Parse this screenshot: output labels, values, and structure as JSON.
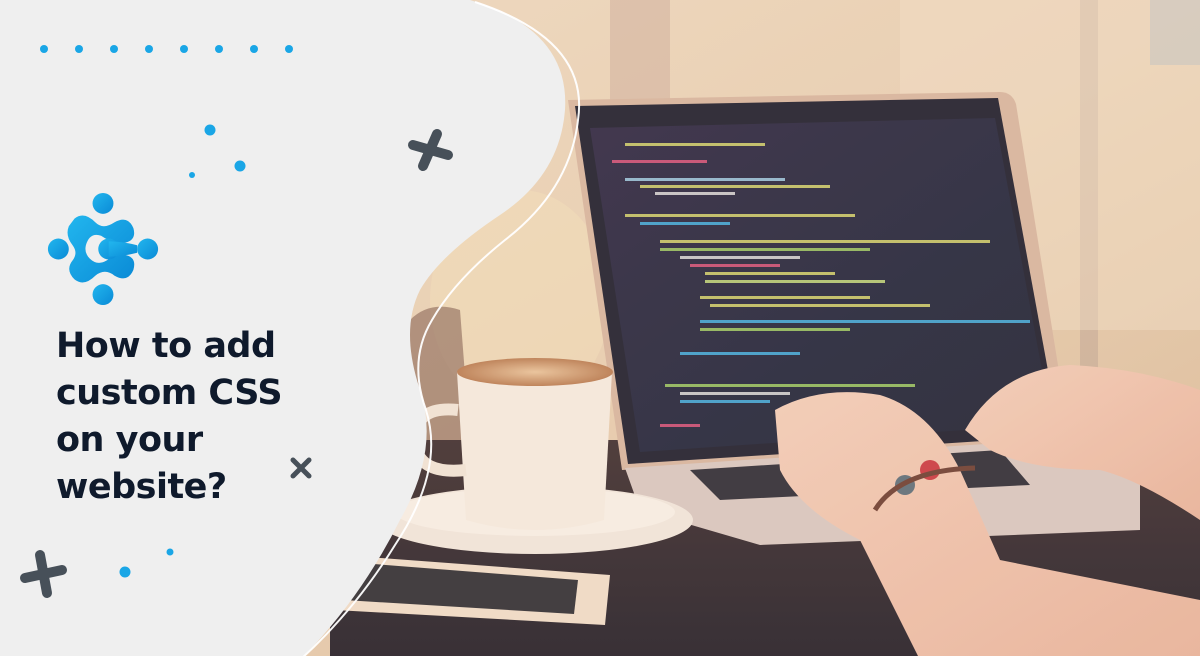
{
  "banner": {
    "heading_lines": [
      "How to add",
      "custom CSS",
      "on your",
      "website?"
    ],
    "logo_icon": "molecule-c-logo-icon",
    "decorations": [
      "dot-row",
      "scattered-dots",
      "plus-icon",
      "close-x-icon"
    ],
    "photo_description": "Hands typing on a laptop showing code, with a latte cup and smartphone on a table",
    "colors": {
      "background": "#efefef",
      "accent": "#1aa6e6",
      "accent_dark": "#0a8ad6",
      "heading": "#0f1a2c",
      "decor_marks": "#475059"
    }
  }
}
